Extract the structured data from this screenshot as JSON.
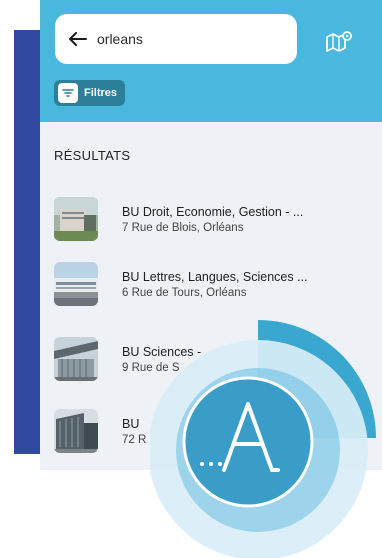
{
  "search": {
    "value": "orleans"
  },
  "filters": {
    "label": "Filtres"
  },
  "results": {
    "heading": "RÉSULTATS",
    "items": [
      {
        "name": "BU Droit, Economie, Gestion - ...",
        "address": "7 Rue de Blois, Orléans"
      },
      {
        "name": "BU Lettres, Langues, Sciences ...",
        "address": "6 Rue de Tours, Orléans"
      },
      {
        "name": "BU Sciences - ",
        "address": "9 Rue de S"
      },
      {
        "name": "BU ",
        "address": "72 R"
      }
    ]
  },
  "logo": {
    "letter": "A",
    "prefix": "..."
  },
  "colors": {
    "header": "#4ab7dc",
    "filters_button": "#2c7f98",
    "page_background": "#eef2f6",
    "backdrop": "#2f4aa0",
    "logo_blue": "#3aa7d1",
    "logo_ring": "#d9eef7"
  }
}
